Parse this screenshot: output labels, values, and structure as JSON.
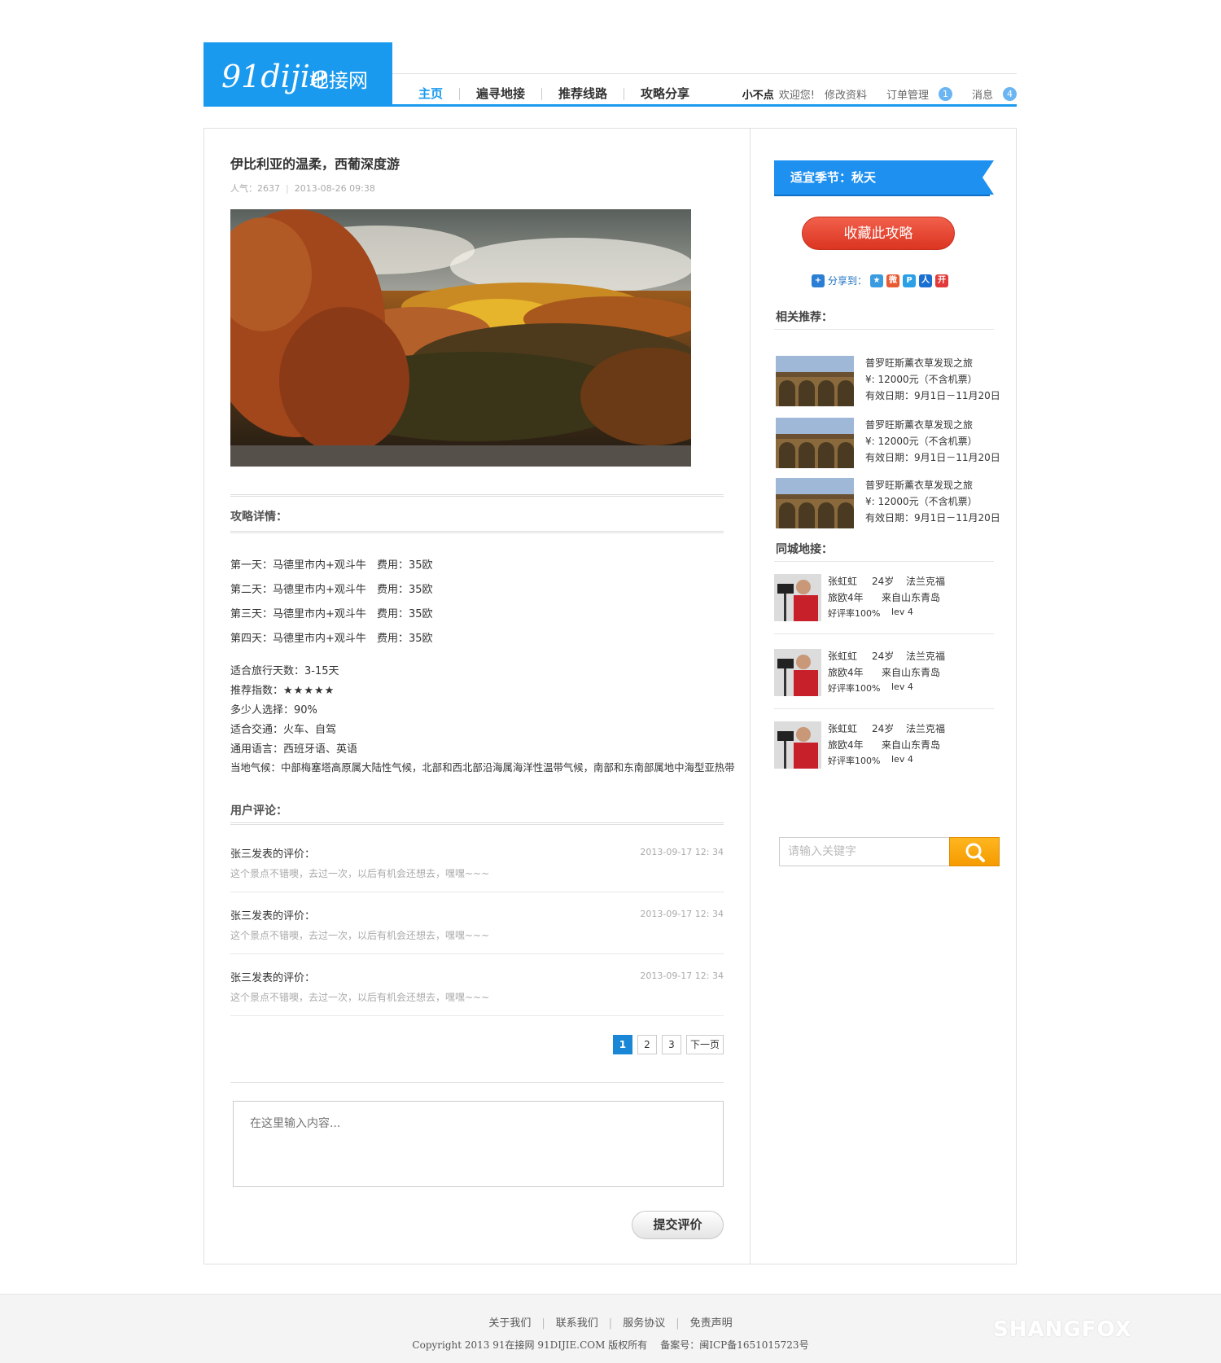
{
  "header": {
    "logo_brand": "91dijie",
    "logo_sub": "地接网",
    "nav": [
      "主页",
      "遍寻地接",
      "推荐线路",
      "攻略分享"
    ],
    "user_name": "小不点",
    "welcome": "欢迎您!",
    "edit_profile": "修改资料",
    "orders": "订单管理",
    "orders_count": "1",
    "messages": "消息",
    "messages_count": "4"
  },
  "article": {
    "title": "伊比利亚的温柔，西葡深度游",
    "popularity": "人气：2637",
    "date": "2013-08-26 09:38"
  },
  "details": {
    "section_title": "攻略详情：",
    "days": [
      {
        "label": "第一天：马德里市内+观斗牛",
        "fee": "费用：35欧"
      },
      {
        "label": "第二天：马德里市内+观斗牛",
        "fee": "费用：35欧"
      },
      {
        "label": "第三天：马德里市内+观斗牛",
        "fee": "费用：35欧"
      },
      {
        "label": "第四天：马德里市内+观斗牛",
        "fee": "费用：35欧"
      }
    ],
    "travel_days": "适合旅行天数：3-15天",
    "rating_label": "推荐指数：",
    "rating_stars": "★★★★★",
    "rating_value": 5,
    "choose": "多少人选择：90%",
    "transport": "适合交通：火车、自驾",
    "language": "通用语言：西班牙语、英语",
    "climate": "当地气候：中部梅塞塔高原属大陆性气候，北部和西北部沿海属海洋性温带气候，南部和东南部属地中海型亚热带"
  },
  "comments": {
    "section_title": "用户评论：",
    "items": [
      {
        "author": "张三发表的评价：",
        "time": "2013-09-17 12: 34",
        "text": "这个景点不错噢，去过一次，以后有机会还想去，嘿嘿~~~"
      },
      {
        "author": "张三发表的评价：",
        "time": "2013-09-17 12: 34",
        "text": "这个景点不错噢，去过一次，以后有机会还想去，嘿嘿~~~"
      },
      {
        "author": "张三发表的评价：",
        "time": "2013-09-17 12: 34",
        "text": "这个景点不错噢，去过一次，以后有机会还想去，嘿嘿~~~"
      }
    ],
    "pages": [
      "1",
      "2",
      "3"
    ],
    "next": "下一页",
    "placeholder": "在这里输入内容...",
    "submit": "提交评价"
  },
  "sidebar": {
    "season": "适宜季节：秋天",
    "favorite": "收藏此攻略",
    "share_label": "分享到：",
    "related_title": "相关推荐：",
    "routes": [
      {
        "name": "普罗旺斯薰衣草发现之旅",
        "price": "¥: 12000元（不含机票）",
        "valid": "有效日期：9月1日－11月20日"
      },
      {
        "name": "普罗旺斯薰衣草发现之旅",
        "price": "¥: 12000元（不含机票）",
        "valid": "有效日期：9月1日－11月20日"
      },
      {
        "name": "普罗旺斯薰衣草发现之旅",
        "price": "¥: 12000元（不含机票）",
        "valid": "有效日期：9月1日－11月20日"
      }
    ],
    "guides_title": "同城地接：",
    "guides": [
      {
        "name": "张虹虹",
        "age": "24岁",
        "city": "法兰克福",
        "years": "旅欧4年",
        "from": "来自山东青岛",
        "rate": "好评率100%",
        "level": "lev 4"
      },
      {
        "name": "张虹虹",
        "age": "24岁",
        "city": "法兰克福",
        "years": "旅欧4年",
        "from": "来自山东青岛",
        "rate": "好评率100%",
        "level": "lev 4"
      },
      {
        "name": "张虹虹",
        "age": "24岁",
        "city": "法兰克福",
        "years": "旅欧4年",
        "from": "来自山东青岛",
        "rate": "好评率100%",
        "level": "lev 4"
      }
    ],
    "search_placeholder": "请输入关键字"
  },
  "footer": {
    "links": [
      "关于我们",
      "联系我们",
      "服务协议",
      "免责声明"
    ],
    "copyright": "Copyright 2013 91在接网 91DIJIE.COM 版权所有",
    "icp": "备案号：闽ICP备1651015723号",
    "watermark": "SHANGFOX"
  },
  "colors": {
    "accent": "#1a9aee",
    "fav": "#e0432f",
    "search": "#f8a90d"
  }
}
